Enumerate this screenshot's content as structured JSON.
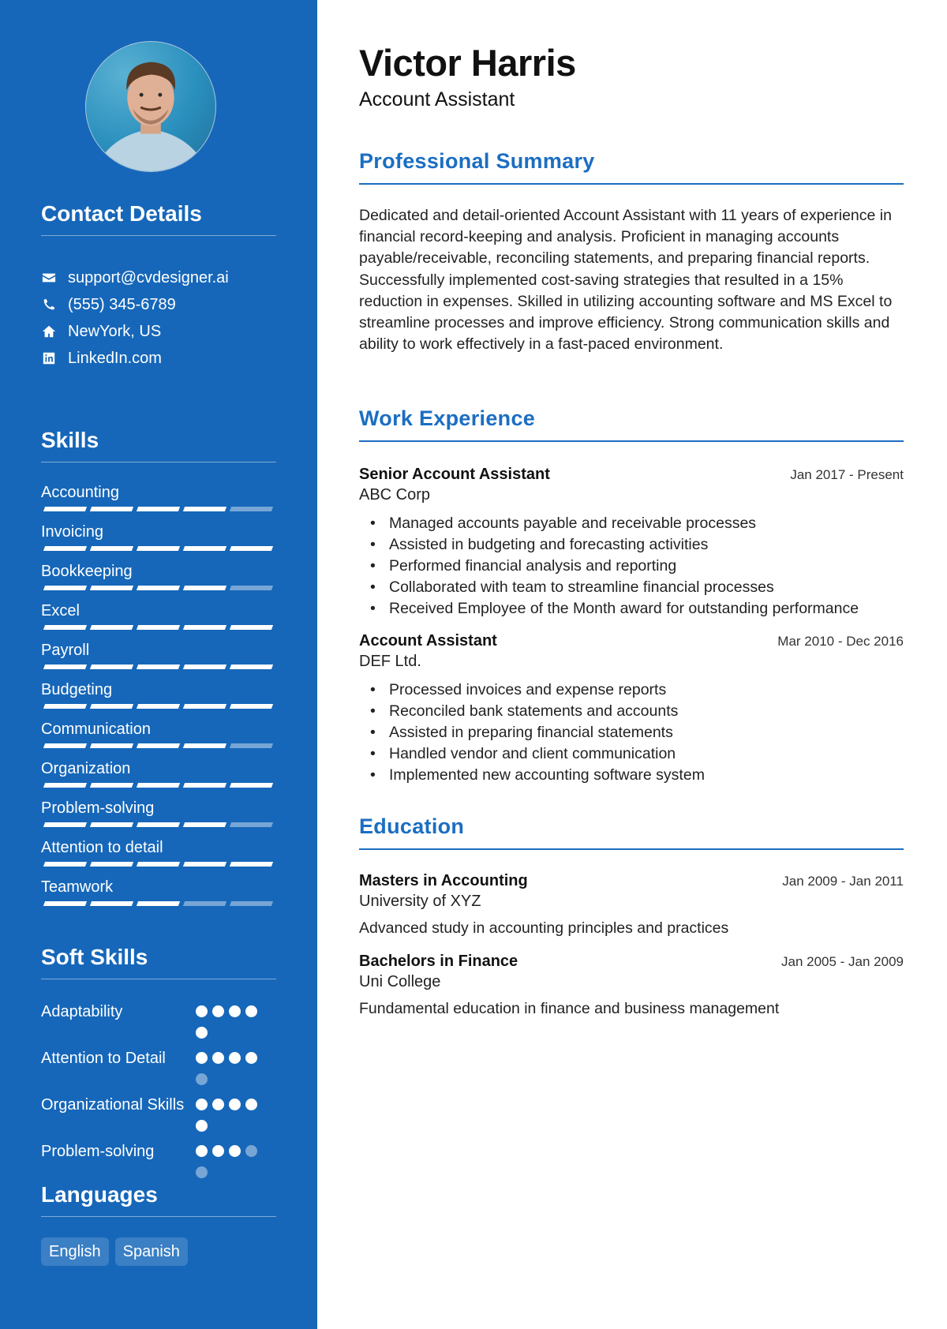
{
  "profile": {
    "name": "Victor Harris",
    "title": "Account Assistant",
    "photo_alt": "Profile photo"
  },
  "colors": {
    "sidebar": "#1667b9",
    "accent": "#1b6ec2"
  },
  "contact": {
    "heading": "Contact Details",
    "items": [
      {
        "icon": "envelope-icon",
        "text": "support@cvdesigner.ai"
      },
      {
        "icon": "phone-icon",
        "text": "(555) 345-6789"
      },
      {
        "icon": "home-icon",
        "text": "NewYork, US"
      },
      {
        "icon": "linkedin-icon",
        "text": "LinkedIn.com"
      }
    ]
  },
  "skills": {
    "heading": "Skills",
    "max": 5,
    "items": [
      {
        "name": "Accounting",
        "level": 4
      },
      {
        "name": "Invoicing",
        "level": 5
      },
      {
        "name": "Bookkeeping",
        "level": 4
      },
      {
        "name": "Excel",
        "level": 5
      },
      {
        "name": "Payroll",
        "level": 5
      },
      {
        "name": "Budgeting",
        "level": 5
      },
      {
        "name": "Communication",
        "level": 4
      },
      {
        "name": "Organization",
        "level": 5
      },
      {
        "name": "Problem-solving",
        "level": 4
      },
      {
        "name": "Attention to detail",
        "level": 5
      },
      {
        "name": "Teamwork",
        "level": 3
      }
    ]
  },
  "soft_skills": {
    "heading": "Soft Skills",
    "max": 5,
    "items": [
      {
        "name": "Adaptability",
        "level": 5
      },
      {
        "name": "Attention to Detail",
        "level": 4
      },
      {
        "name": "Organizational Skills",
        "level": 5
      },
      {
        "name": "Problem-solving",
        "level": 3
      }
    ]
  },
  "languages": {
    "heading": "Languages",
    "items": [
      "English",
      "Spanish"
    ]
  },
  "summary": {
    "heading": "Professional Summary",
    "text": "Dedicated and detail-oriented Account Assistant with 11 years of experience in financial record-keeping and analysis. Proficient in managing accounts payable/receivable, reconciling statements, and preparing financial reports. Successfully implemented cost-saving strategies that resulted in a 15% reduction in expenses. Skilled in utilizing accounting software and MS Excel to streamline processes and improve efficiency. Strong communication skills and ability to work effectively in a fast-paced environment."
  },
  "experience": {
    "heading": "Work Experience",
    "jobs": [
      {
        "title": "Senior Account Assistant",
        "company": "ABC Corp",
        "dates": "Jan 2017 - Present",
        "bullets": [
          "Managed accounts payable and receivable processes",
          "Assisted in budgeting and forecasting activities",
          "Performed financial analysis and reporting",
          "Collaborated with team to streamline financial processes",
          "Received Employee of the Month award for outstanding performance"
        ]
      },
      {
        "title": "Account Assistant",
        "company": "DEF Ltd.",
        "dates": "Mar 2010 - Dec 2016",
        "bullets": [
          "Processed invoices and expense reports",
          "Reconciled bank statements and accounts",
          "Assisted in preparing financial statements",
          "Handled vendor and client communication",
          "Implemented new accounting software system"
        ]
      }
    ]
  },
  "education": {
    "heading": "Education",
    "items": [
      {
        "degree": "Masters in Accounting",
        "school": "University of XYZ",
        "dates": "Jan 2009 - Jan 2011",
        "description": "Advanced study in accounting principles and practices"
      },
      {
        "degree": "Bachelors in Finance",
        "school": "Uni College",
        "dates": "Jan 2005 - Jan 2009",
        "description": "Fundamental education in finance and business management"
      }
    ]
  }
}
